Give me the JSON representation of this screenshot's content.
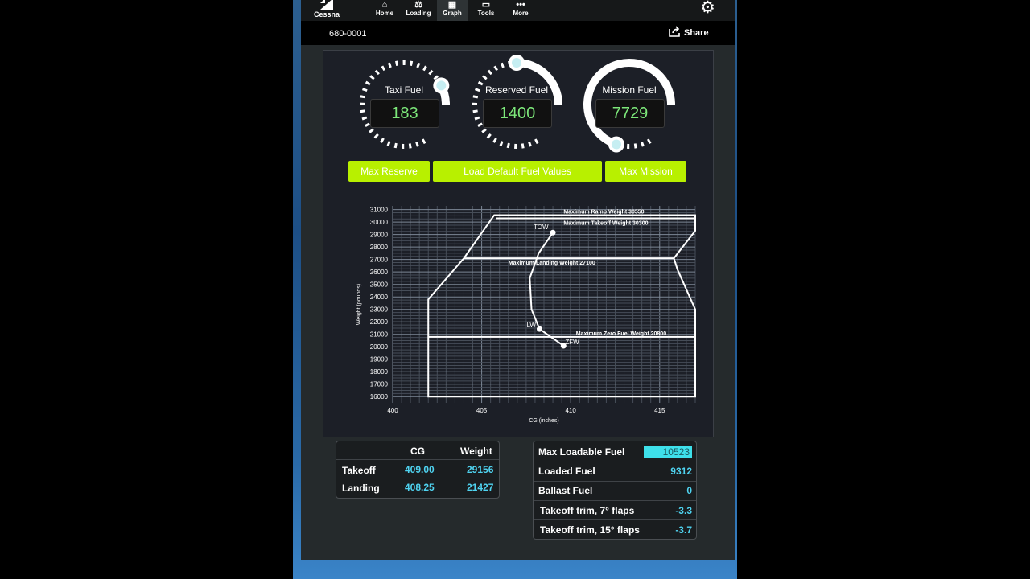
{
  "app": {
    "brand": "Cessna",
    "tail_number": "680-0001",
    "share_label": "Share"
  },
  "nav": {
    "items": [
      {
        "label": "Home",
        "icon": "home-icon"
      },
      {
        "label": "Loading",
        "icon": "scale-icon"
      },
      {
        "label": "Graph",
        "icon": "graph-icon",
        "active": true
      },
      {
        "label": "Tools",
        "icon": "tools-icon"
      },
      {
        "label": "More",
        "icon": "more-icon"
      }
    ]
  },
  "gauges": [
    {
      "label": "Taxi Fuel",
      "value": "183",
      "fraction": 0.09
    },
    {
      "label": "Reserved Fuel",
      "value": "1400",
      "fraction": 0.3
    },
    {
      "label": "Mission Fuel",
      "value": "7729",
      "fraction": 0.84
    }
  ],
  "buttons": {
    "max_reserve": "Max Reserve",
    "load_default": "Load Default Fuel Values",
    "max_mission": "Max Mission"
  },
  "chart_data": {
    "type": "line",
    "xlabel": "CG (inches)",
    "ylabel": "Weight (pounds)",
    "xlim": [
      400,
      417
    ],
    "ylim": [
      15500,
      31300
    ],
    "x_ticks": [
      400,
      405,
      410,
      415
    ],
    "y_ticks": [
      16000,
      17000,
      18000,
      19000,
      20000,
      21000,
      22000,
      23000,
      24000,
      25000,
      26000,
      27000,
      28000,
      29000,
      30000,
      31000
    ],
    "grid": true,
    "envelope": [
      [
        402,
        16000
      ],
      [
        402,
        23800
      ],
      [
        404,
        27100
      ],
      [
        405.7,
        30550
      ],
      [
        417,
        30550
      ],
      [
        417,
        29300
      ],
      [
        415.8,
        27100
      ],
      [
        416,
        26200
      ],
      [
        417,
        23000
      ],
      [
        417,
        16000
      ]
    ],
    "limits": [
      {
        "label": "Maximum Ramp Weight 30550",
        "y": 30550,
        "x0": 405.7,
        "x1": 417
      },
      {
        "label": "Maximum Takeoff Weight 30300",
        "y": 30300,
        "x0": 405.8,
        "x1": 417
      },
      {
        "label": "Maximum Landing Weight 27100",
        "y": 27100,
        "x0": 404,
        "x1": 415.8
      },
      {
        "label": "Maximum Zero Fuel Weight 20800",
        "y": 20800,
        "x0": 402,
        "x1": 417
      }
    ],
    "path": [
      [
        409,
        29156
      ],
      [
        408.2,
        27500
      ],
      [
        407.7,
        25500
      ],
      [
        407.8,
        23000
      ],
      [
        408.25,
        21427
      ],
      [
        409.6,
        20080
      ]
    ],
    "points": [
      {
        "label": "TOW",
        "x": 409,
        "y": 29156
      },
      {
        "label": "LW",
        "x": 408.25,
        "y": 21427
      },
      {
        "label": "ZFW",
        "x": 409.6,
        "y": 20080
      }
    ]
  },
  "cg_table": {
    "headers": [
      "",
      "CG",
      "Weight"
    ],
    "rows": [
      {
        "label": "Takeoff",
        "cg": "409.00",
        "weight": "29156"
      },
      {
        "label": "Landing",
        "cg": "408.25",
        "weight": "21427"
      }
    ]
  },
  "fuel_table": {
    "rows": [
      {
        "label": "Max Loadable Fuel",
        "value": "10523",
        "highlight": true
      },
      {
        "label": "Loaded Fuel",
        "value": "9312"
      },
      {
        "label": "Ballast Fuel",
        "value": "0"
      },
      {
        "label": "Takeoff trim, 7° flaps",
        "value": "-3.3"
      },
      {
        "label": "Takeoff trim, 15° flaps",
        "value": "-3.7"
      }
    ]
  }
}
